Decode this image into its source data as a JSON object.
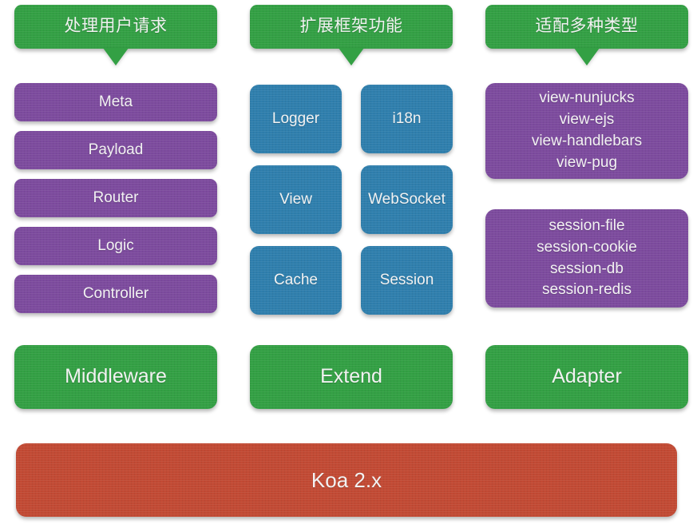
{
  "diagram": {
    "background_color": "#ffffff",
    "palette": {
      "green": "#33a044",
      "purple": "#7d4b9e",
      "blue": "#2f7fad",
      "red": "#c24a34",
      "text": "#f2f2f2"
    }
  },
  "callouts": [
    {
      "label": "处理用户请求"
    },
    {
      "label": "扩展框架功能"
    },
    {
      "label": "适配多种类型"
    }
  ],
  "middleware_stack": [
    {
      "label": "Meta"
    },
    {
      "label": "Payload"
    },
    {
      "label": "Router"
    },
    {
      "label": "Logic"
    },
    {
      "label": "Controller"
    }
  ],
  "extend_tiles": [
    {
      "label": "Logger"
    },
    {
      "label": "i18n"
    },
    {
      "label": "View"
    },
    {
      "label": "WebSocket"
    },
    {
      "label": "Cache"
    },
    {
      "label": "Session"
    }
  ],
  "adapter_cards": [
    {
      "items": [
        "view-nunjucks",
        "view-ejs",
        "view-handlebars",
        "view-pug"
      ]
    },
    {
      "items": [
        "session-file",
        "session-cookie",
        "session-db",
        "session-redis"
      ]
    }
  ],
  "layer_labels": [
    {
      "label": "Middleware"
    },
    {
      "label": "Extend"
    },
    {
      "label": "Adapter"
    }
  ],
  "base": {
    "label": "Koa 2.x"
  }
}
